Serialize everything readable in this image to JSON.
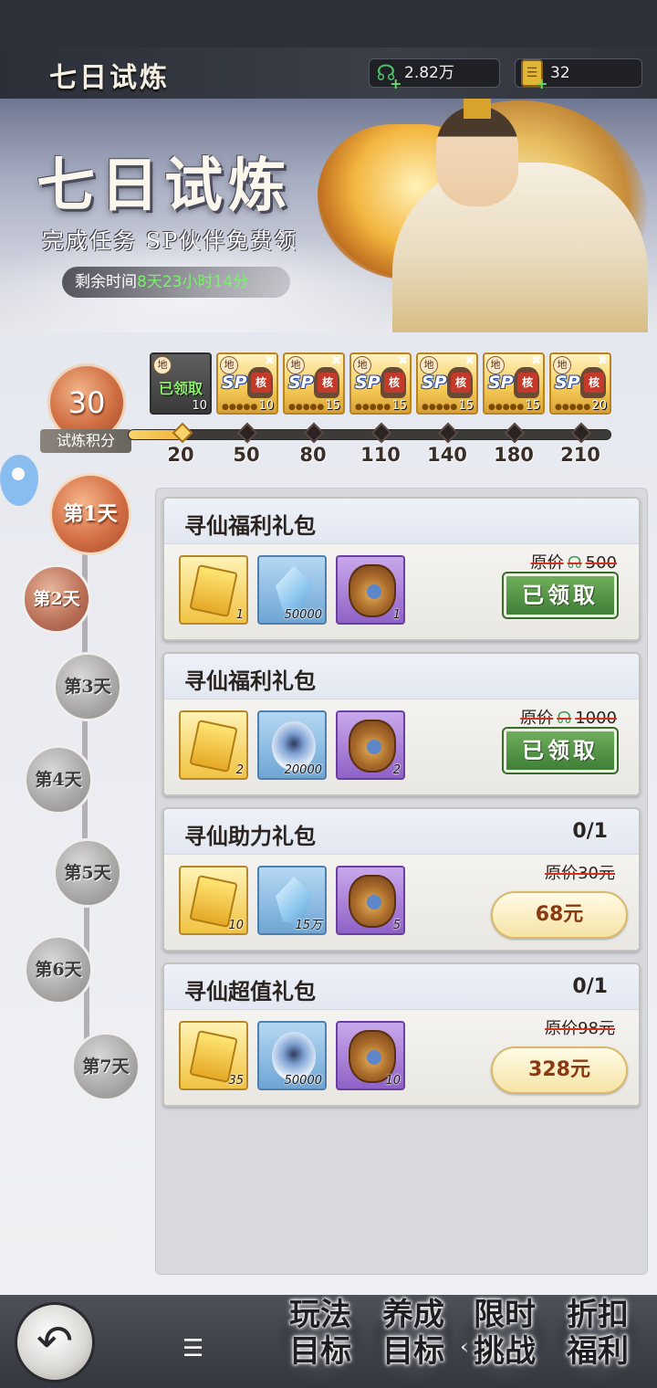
{
  "header": {
    "title": "七日试炼",
    "jade": "2.82万",
    "tickets": "32",
    "plus": "+"
  },
  "banner": {
    "title": "七日试炼",
    "subtitle": "完成任务 SP伙伴免费领",
    "time_label": "剩余时间",
    "time_remaining": "8天23小时14分"
  },
  "progress": {
    "score": "30",
    "score_label": "试炼积分",
    "fill_fraction": 0.115,
    "milestones": [
      "20",
      "50",
      "80",
      "110",
      "140",
      "180",
      "210"
    ],
    "rewards": [
      {
        "di": "地",
        "count": "10",
        "claimed_text": "已领取"
      },
      {
        "di": "地",
        "sp": "SP",
        "hexin": "核",
        "count": "10"
      },
      {
        "di": "地",
        "sp": "SP",
        "hexin": "核",
        "count": "15"
      },
      {
        "di": "地",
        "sp": "SP",
        "hexin": "核",
        "count": "15"
      },
      {
        "di": "地",
        "sp": "SP",
        "hexin": "核",
        "count": "15"
      },
      {
        "di": "地",
        "sp": "SP",
        "hexin": "核",
        "count": "15"
      },
      {
        "di": "地",
        "sp": "SP",
        "hexin": "核",
        "count": "20"
      }
    ]
  },
  "days": [
    "第1天",
    "第2天",
    "第3天",
    "第4天",
    "第5天",
    "第6天",
    "第7天"
  ],
  "packs": [
    {
      "title": "寻仙福利礼包",
      "orig_label": "原价",
      "orig_price": "500",
      "button": "已领取",
      "items": [
        "1",
        "50000",
        "1"
      ]
    },
    {
      "title": "寻仙福利礼包",
      "orig_label": "原价",
      "orig_price": "1000",
      "button": "已领取",
      "items": [
        "2",
        "20000",
        "2"
      ]
    },
    {
      "title": "寻仙助力礼包",
      "progress": "0/1",
      "orig_price_text": "原价30元",
      "button": "68元",
      "items": [
        "10",
        "15万",
        "5"
      ]
    },
    {
      "title": "寻仙超值礼包",
      "progress": "0/1",
      "orig_price_text": "原价98元",
      "button": "328元",
      "items": [
        "35",
        "50000",
        "10"
      ]
    }
  ],
  "bottom_nav": [
    {
      "line1": "玩法",
      "line2": "目标"
    },
    {
      "line1": "养成",
      "line2": "目标"
    },
    {
      "line1": "限时",
      "line2": "挑战"
    },
    {
      "line1": "折扣",
      "line2": "福利"
    }
  ],
  "icons": {
    "back": "back-arrow-icon",
    "jade": "jade-dragon-icon",
    "ticket": "gold-ticket-icon",
    "menu": "menu-icon",
    "sys_back": "chevron-left-icon"
  },
  "colors": {
    "accent_orange": "#d06e42",
    "claimed_green": "#4f8f42",
    "price_brown": "#8a3a12",
    "timer_green": "#7cf06e"
  }
}
